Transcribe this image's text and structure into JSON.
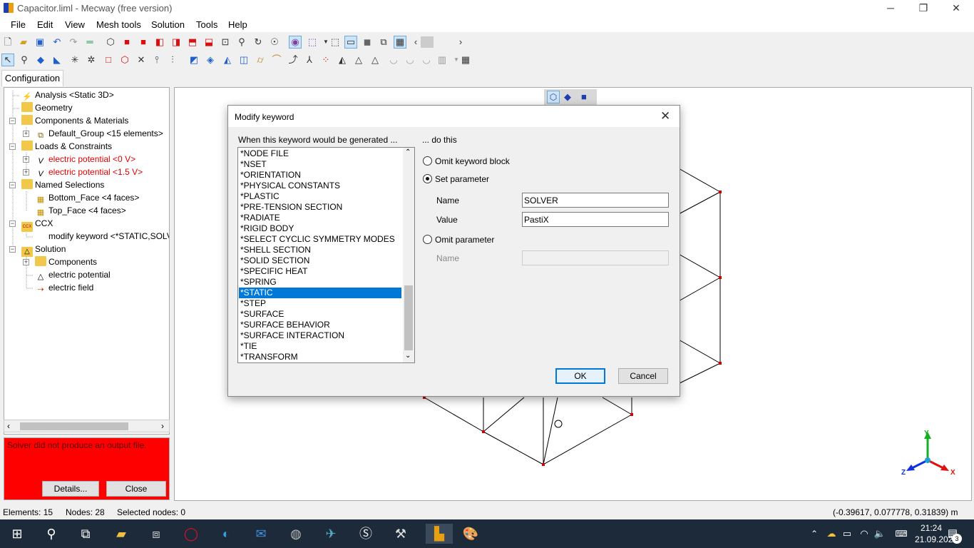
{
  "window": {
    "title": "Capacitor.liml - Mecway (free version)",
    "minimize": "─",
    "maximize": "❐",
    "close": "✕"
  },
  "menu": [
    "File",
    "Edit",
    "View",
    "Mesh tools",
    "Solution",
    "Tools",
    "Help"
  ],
  "tabs": {
    "configuration": "Configuration"
  },
  "tree": {
    "analysis": "Analysis <Static 3D>",
    "geometry": "Geometry",
    "components_materials": "Components & Materials",
    "default_group": "Default_Group <15 elements>",
    "loads_constraints": "Loads & Constraints",
    "ep0": "electric potential <0 V>",
    "ep15": "electric potential <1.5 V>",
    "named_selections": "Named Selections",
    "bottom_face": "Bottom_Face <4 faces>",
    "top_face": "Top_Face <4 faces>",
    "ccx": "CCX",
    "modify_keyword": "modify keyword <*STATIC,SOLVER=PastiX>",
    "solution": "Solution",
    "components": "Components",
    "electric_potential": "electric potential",
    "electric_field": "electric field"
  },
  "error_panel": {
    "message": "Solver did not produce an output file.",
    "details_label": "Details...",
    "close_label": "Close"
  },
  "dialog": {
    "title": "Modify keyword",
    "list_header": "When this keyword would be generated ...",
    "action_header": "... do this",
    "keywords": [
      "*NODE FILE",
      "*NSET",
      "*ORIENTATION",
      "*PHYSICAL CONSTANTS",
      "*PLASTIC",
      "*PRE-TENSION SECTION",
      "*RADIATE",
      "*RIGID BODY",
      "*SELECT CYCLIC SYMMETRY MODES",
      "*SHELL SECTION",
      "*SOLID SECTION",
      "*SPECIFIC HEAT",
      "*SPRING",
      "*STATIC",
      "*STEP",
      "*SURFACE",
      "*SURFACE BEHAVIOR",
      "*SURFACE INTERACTION",
      "*TIE",
      "*TRANSFORM"
    ],
    "selected_keyword": "*STATIC",
    "omit_keyword_block": "Omit keyword block",
    "set_parameter": "Set parameter",
    "name_label": "Name",
    "value_label": "Value",
    "name_value": "SOLVER",
    "value_value": "PastiX",
    "omit_parameter": "Omit parameter",
    "omit_name_label": "Name",
    "omit_name_value": "",
    "ok_label": "OK",
    "cancel_label": "Cancel",
    "selected_option": "set_parameter"
  },
  "axes": {
    "x": "X",
    "y": "Y",
    "z": "Z"
  },
  "status": {
    "elements": "Elements: 15",
    "nodes": "Nodes: 28",
    "selected_nodes": "Selected nodes: 0",
    "coords": "(-0.39617, 0.077778, 0.31839) m"
  },
  "taskbar": {
    "time": "21:24",
    "date": "21.09.2021",
    "notifications": "3"
  },
  "colors": {
    "selection": "#0078d7",
    "error_bg": "#ff0000",
    "load_text": "#e00000"
  }
}
